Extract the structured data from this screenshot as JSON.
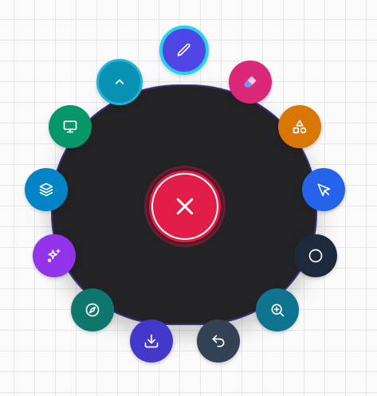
{
  "radial_menu": {
    "center_action": {
      "icon": "close-icon",
      "color": "#e11d48"
    },
    "tools": [
      {
        "name": "pen",
        "icon": "pencil-icon",
        "color": "#4f46e5",
        "state": "selected"
      },
      {
        "name": "eraser",
        "icon": "eraser-icon",
        "color": "#db2777"
      },
      {
        "name": "shapes",
        "icon": "shapes-icon",
        "color": "#d97706"
      },
      {
        "name": "select",
        "icon": "cursor-pointer-icon",
        "color": "#2563eb"
      },
      {
        "name": "circle",
        "icon": "circle-icon",
        "color": "#1e293b"
      },
      {
        "name": "zoom-in",
        "icon": "zoom-in-icon",
        "color": "#0e7490"
      },
      {
        "name": "undo",
        "icon": "undo-icon",
        "color": "#334155"
      },
      {
        "name": "download",
        "icon": "download-icon",
        "color": "#4338ca"
      },
      {
        "name": "navigate",
        "icon": "compass-icon",
        "color": "#0f766e"
      },
      {
        "name": "effects",
        "icon": "sparkles-icon",
        "color": "#9333ea"
      },
      {
        "name": "layers",
        "icon": "layers-icon",
        "color": "#0284c7"
      },
      {
        "name": "present",
        "icon": "monitor-icon",
        "color": "#059669"
      },
      {
        "name": "collapse",
        "icon": "chevron-up-icon",
        "color": "#0891b2"
      }
    ]
  }
}
